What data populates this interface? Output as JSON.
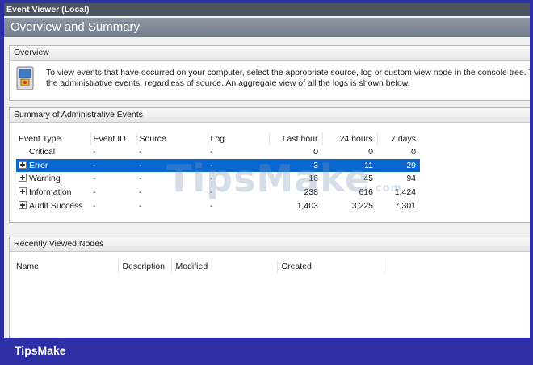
{
  "window": {
    "title": "Event Viewer (Local)"
  },
  "banner": {
    "title": "Overview and Summary"
  },
  "overview": {
    "header": "Overview",
    "line1": "To view events that have occurred on your computer, select the appropriate source, log or custom view node in the console tree. The",
    "line2": "the administrative events, regardless of source. An aggregate view of all the logs is shown below.",
    "icon": "event-log-icon"
  },
  "summary": {
    "header": "Summary of Administrative Events",
    "columns": [
      "Event Type",
      "Event ID",
      "Source",
      "Log",
      "Last hour",
      "24 hours",
      "7 days"
    ],
    "rows": [
      {
        "type": "Critical",
        "id": "-",
        "source": "-",
        "log": "-",
        "last_hour": "0",
        "h24": "0",
        "d7": "0",
        "expandable": false,
        "selected": false
      },
      {
        "type": "Error",
        "id": "-",
        "source": "-",
        "log": "-",
        "last_hour": "3",
        "h24": "11",
        "d7": "29",
        "expandable": true,
        "selected": true
      },
      {
        "type": "Warning",
        "id": "-",
        "source": "-",
        "log": "-",
        "last_hour": "16",
        "h24": "45",
        "d7": "94",
        "expandable": true,
        "selected": false
      },
      {
        "type": "Information",
        "id": "-",
        "source": "-",
        "log": "-",
        "last_hour": "238",
        "h24": "616",
        "d7": "1,424",
        "expandable": true,
        "selected": false
      },
      {
        "type": "Audit Success",
        "id": "-",
        "source": "-",
        "log": "-",
        "last_hour": "1,403",
        "h24": "3,225",
        "d7": "7,301",
        "expandable": true,
        "selected": false
      }
    ],
    "selected_color": "#0a67cf"
  },
  "recent": {
    "header": "Recently Viewed Nodes",
    "columns": [
      "Name",
      "Description",
      "Modified",
      "Created"
    ]
  },
  "watermark": {
    "text": "TipsMake",
    "suffix": ".com"
  },
  "brand": {
    "label": "TipsMake",
    "bar_color": "#2d2fa6"
  }
}
